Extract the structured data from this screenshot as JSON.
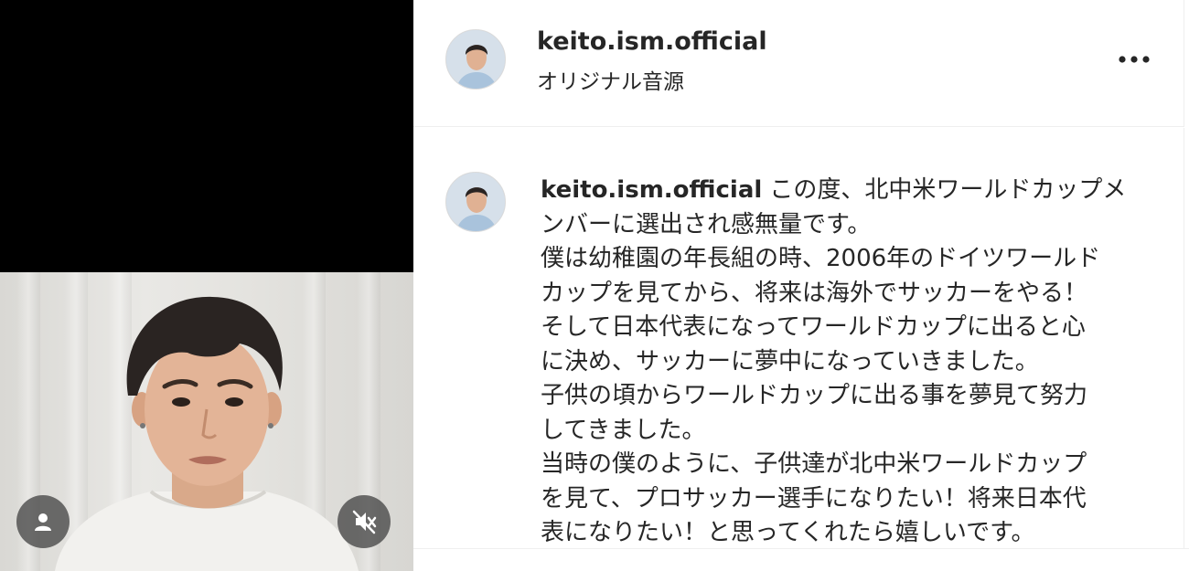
{
  "post": {
    "username": "keito.ism.official",
    "audio": "オリジナル音源",
    "more_icon": "more-horizontal-icon",
    "caption_lines": [
      "この度、北中米ワールドカップメ",
      "ンバーに選出され感無量です。",
      "僕は幼稚園の年長組の時、2006年のドイツワールド",
      "カップを見てから、将来は海外でサッカーをやる！",
      "そして日本代表になってワールドカップに出ると心",
      "に決め、サッカーに夢中になっていきました。",
      "子供の頃からワールドカップに出る事を夢見て努力",
      "してきました。",
      "当時の僕のように、子供達が北中米ワールドカップ",
      "を見て、プロサッカー選手になりたい！将来日本代",
      "表になりたい！と思ってくれたら嬉しいです。"
    ]
  },
  "video": {
    "tags_button_icon": "user-icon",
    "mute_button_icon": "volume-muted-icon"
  },
  "colors": {
    "text": "#262626",
    "divider": "#efefef",
    "overlay_button": "#464646"
  }
}
